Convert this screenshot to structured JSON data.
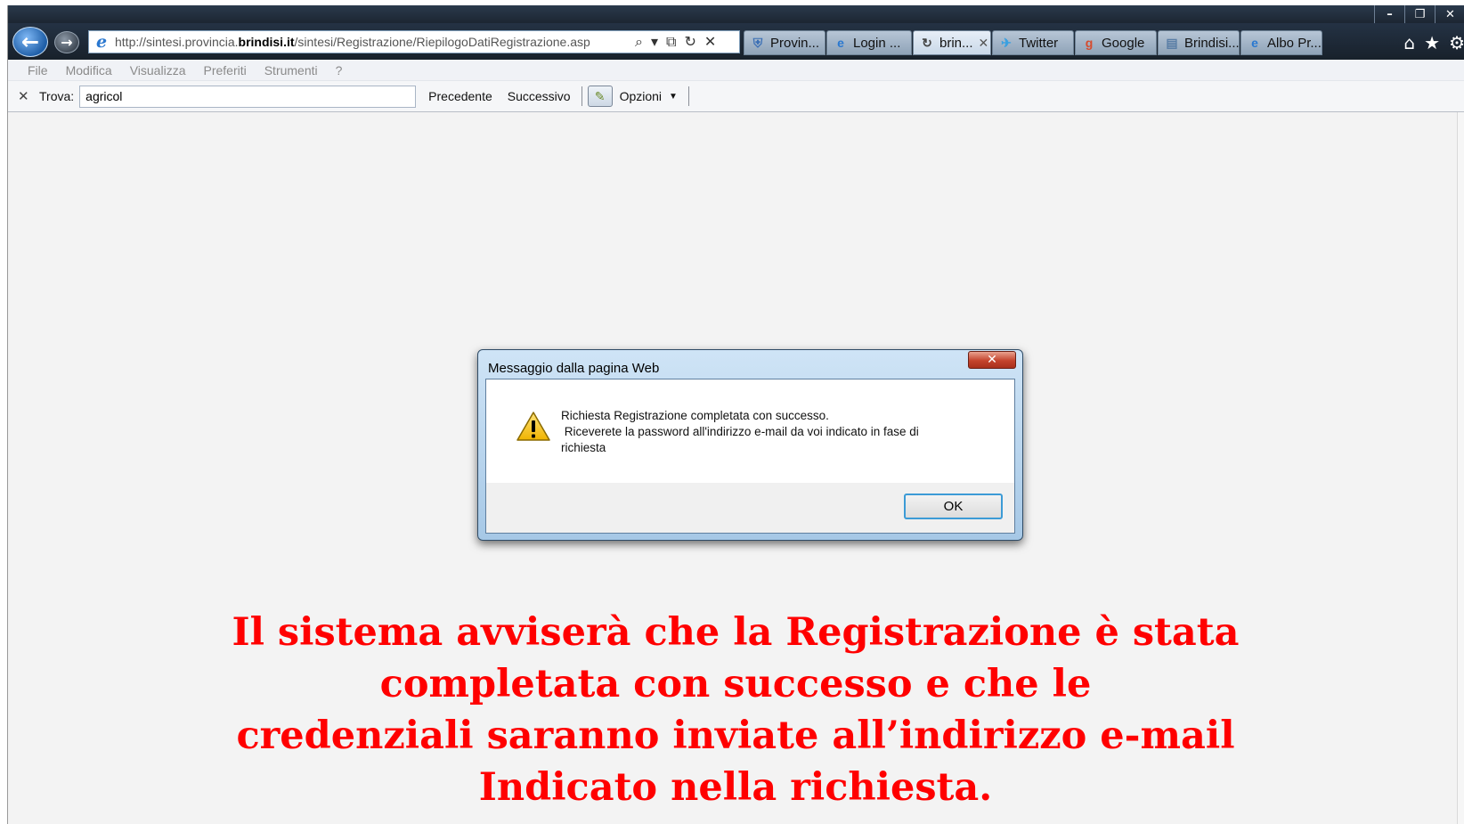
{
  "window": {
    "minimize": "–",
    "restore": "❐",
    "close": "✕"
  },
  "nav": {
    "back_icon": "←",
    "forward_icon": "→",
    "url_prefix": "http://sintesi.provincia.",
    "url_host": "brindisi.it",
    "url_path": "/sintesi/Registrazione/RiepilogoDatiRegistrazione.asp",
    "ie_icon": "e",
    "search_glyph": "⌕",
    "dropdown_glyph": "▾",
    "compat_glyph": "⧉",
    "refresh_glyph": "↻",
    "stop_glyph": "✕"
  },
  "tabs": [
    {
      "label": "Provin...",
      "icon": "crest",
      "icon_glyph": "⛨",
      "icon_color": "#3b6fb5",
      "active": false
    },
    {
      "label": "Login ...",
      "icon": "ie",
      "icon_glyph": "e",
      "icon_color": "#2a78d0",
      "active": false
    },
    {
      "label": "brin...",
      "icon": "loading",
      "icon_glyph": "↻",
      "icon_color": "#444444",
      "active": true,
      "close": "✕"
    },
    {
      "label": "Twitter",
      "icon": "twitter",
      "icon_glyph": "✈",
      "icon_color": "#3aa0e0",
      "active": false
    },
    {
      "label": "Google",
      "icon": "google",
      "icon_glyph": "g",
      "icon_color": "#d64b2e",
      "active": false
    },
    {
      "label": "Brindisi...",
      "icon": "page",
      "icon_glyph": "▤",
      "icon_color": "#5a7ea6",
      "active": false
    },
    {
      "label": "Albo Pr...",
      "icon": "ie",
      "icon_glyph": "e",
      "icon_color": "#2a78d0",
      "active": false
    }
  ],
  "toolbar_right": {
    "home": "⌂",
    "favorites": "★",
    "tools": "⚙"
  },
  "menu": [
    "File",
    "Modifica",
    "Visualizza",
    "Preferiti",
    "Strumenti",
    "?"
  ],
  "findbar": {
    "close": "✕",
    "label": "Trova:",
    "value": "agricol",
    "previous": "Precedente",
    "next": "Successivo",
    "highlight_glyph": "✎",
    "options": "Opzioni",
    "options_caret": "▼"
  },
  "dialog": {
    "title": "Messaggio dalla pagina Web",
    "close": "✕",
    "message_lines": [
      "Richiesta Registrazione completata con successo.",
      " Riceverete la password all'indirizzo e-mail da voi indicato in fase di",
      "richiesta"
    ],
    "ok_label": "OK"
  },
  "caption": {
    "lines": [
      "Il sistema avviserà che la Registrazione è stata",
      "completata con successo e che le",
      "credenziali saranno inviate all’indirizzo e-mail",
      "Indicato nella richiesta."
    ],
    "color": "#ff0000"
  }
}
